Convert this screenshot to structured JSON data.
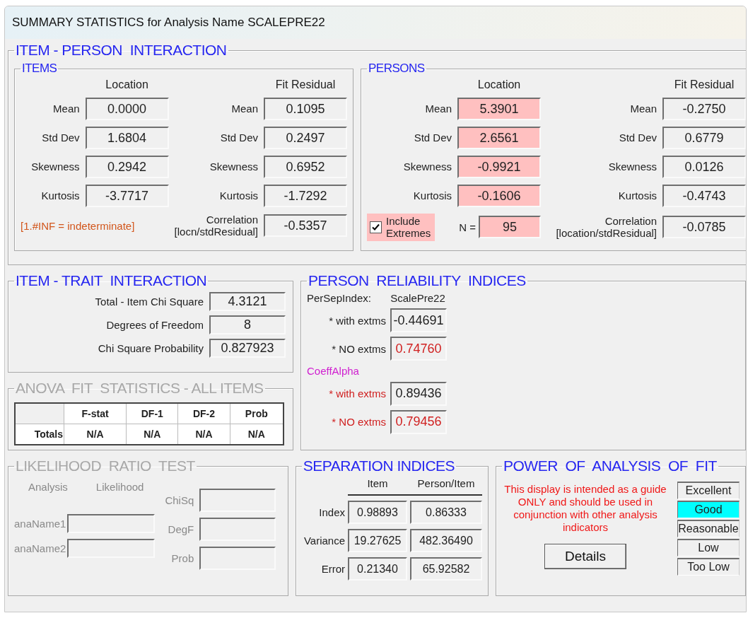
{
  "window": {
    "title": "SUMMARY STATISTICS for Analysis Name SCALEPRE22"
  },
  "item_person": {
    "title": "ITEM - PERSON  INTERACTION",
    "items": {
      "title": "ITEMS",
      "location_header": "Location",
      "fit_header": "Fit Residual",
      "rows": [
        {
          "location_label": "Mean",
          "location": "0.0000",
          "location_highlighted": false,
          "fit_label": "Mean",
          "fit": "0.1095"
        },
        {
          "location_label": "Std Dev",
          "location": "1.6804",
          "location_highlighted": false,
          "fit_label": "Std Dev",
          "fit": "0.2497"
        },
        {
          "location_label": "Skewness",
          "location": "0.2942",
          "location_highlighted": false,
          "fit_label": "Skewness",
          "fit": "0.6952"
        },
        {
          "location_label": "Kurtosis",
          "location": "-3.7717",
          "location_highlighted": false,
          "fit_label": "Kurtosis",
          "fit": "-1.7292"
        }
      ],
      "note": "[1.#INF = indeterminate]",
      "correlation": {
        "label": "Correlation\n[locn/stdResidual]",
        "value": "-0.5357"
      }
    },
    "persons": {
      "title": "PERSONS",
      "location_header": "Location",
      "fit_header": "Fit Residual",
      "rows": [
        {
          "location_label": "Mean",
          "location": "5.3901",
          "location_highlighted": true,
          "fit_label": "Mean",
          "fit": "-0.2750"
        },
        {
          "location_label": "Std Dev",
          "location": "2.6561",
          "location_highlighted": true,
          "fit_label": "Std Dev",
          "fit": "0.6779"
        },
        {
          "location_label": "Skewness",
          "location": "-0.9921",
          "location_highlighted": true,
          "fit_label": "Skewness",
          "fit": "0.0126"
        },
        {
          "location_label": "Kurtosis",
          "location": "-0.1606",
          "location_highlighted": true,
          "fit_label": "Kurtosis",
          "fit": "-0.4743"
        }
      ],
      "extremes": {
        "label": "Include\nExtremes",
        "checked": true,
        "highlighted": true
      },
      "n": {
        "label": "N =",
        "value": "95",
        "highlighted": true
      },
      "correlation": {
        "label": "Correlation\n[location/stdResidual]",
        "value": "-0.0785"
      }
    }
  },
  "item_trait": {
    "title": "ITEM - TRAIT  INTERACTION",
    "rows": [
      {
        "label": "Total - Item Chi Square",
        "value": "4.3121"
      },
      {
        "label": "Degrees of Freedom",
        "value": "8"
      },
      {
        "label": "Chi Square Probability",
        "value": "0.827923"
      }
    ]
  },
  "anova": {
    "title": "ANOVA  FIT  STATISTICS - ALL ITEMS",
    "disabled": true,
    "columns": [
      "F-stat",
      "DF-1",
      "DF-2",
      "Prob"
    ],
    "rows": [
      {
        "label": "Totals",
        "cells": [
          "N/A",
          "N/A",
          "N/A",
          "N/A"
        ]
      }
    ]
  },
  "reliability": {
    "title": "PERSON  RELIABILITY  INDICES",
    "sep_index": {
      "label": "PerSepIndex:",
      "column": "ScalePre22",
      "rows": [
        {
          "label": "* with extms",
          "value": "-0.44691",
          "flagged": false
        },
        {
          "label": "* NO extms",
          "value": "0.74760",
          "flagged": true
        }
      ]
    },
    "coeff_alpha": {
      "label": "CoeffAlpha",
      "rows": [
        {
          "label": "* with extms",
          "value": "0.89436",
          "flagged": false
        },
        {
          "label": "* NO extms",
          "value": "0.79456",
          "flagged": true
        }
      ]
    }
  },
  "likelihood": {
    "title": "LIKELIHOOD  RATIO  TEST",
    "disabled": true,
    "headers": [
      "Analysis",
      "Likelihood"
    ],
    "names": [
      {
        "label": "anaName1"
      },
      {
        "label": "anaName2"
      }
    ],
    "stats": [
      {
        "label": "ChiSq"
      },
      {
        "label": "DegF"
      },
      {
        "label": "Prob"
      }
    ]
  },
  "separation": {
    "title": "SEPARATION INDICES",
    "columns": [
      "Item",
      "Person/Item"
    ],
    "rows": [
      {
        "label": "Index",
        "values": [
          "0.98893",
          "0.86333"
        ]
      },
      {
        "label": "Variance",
        "values": [
          "19.27625",
          "482.36490"
        ]
      },
      {
        "label": "Error",
        "values": [
          "0.21340",
          "65.92582"
        ]
      }
    ]
  },
  "power": {
    "title": "POWER  OF  ANALYSIS  OF  FIT",
    "message": "This display is intended as a guide ONLY and should be used in conjunction with other analysis indicators",
    "button": "Details",
    "ratings": [
      {
        "label": "Excellent",
        "selected": false
      },
      {
        "label": "Good",
        "selected": true
      },
      {
        "label": "Reasonable",
        "selected": false
      },
      {
        "label": "Low",
        "selected": false
      },
      {
        "label": "Too Low",
        "selected": false
      }
    ]
  }
}
